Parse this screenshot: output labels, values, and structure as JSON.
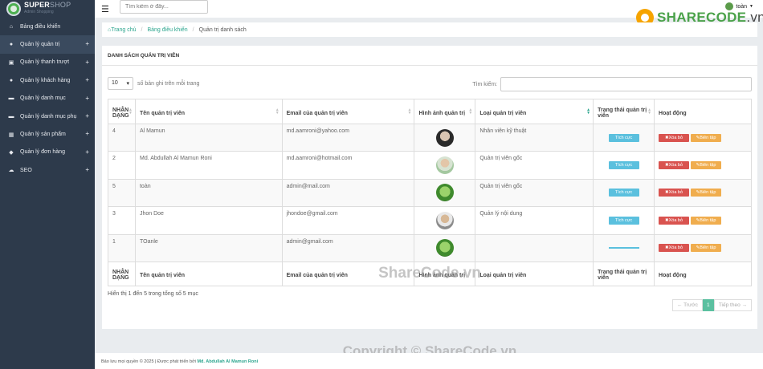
{
  "brand": {
    "title_strong": "SUPER",
    "title_light": "SHOP",
    "subtitle": "Admin Shopping",
    "logo_icon": "shop-logo-icon"
  },
  "sidebar": {
    "items": [
      {
        "label": "Bảng điều khiển",
        "icon": "home-icon",
        "glyph": "⌂",
        "expandable": false
      },
      {
        "label": "Quản lý quản trị",
        "icon": "user-icon",
        "glyph": "●",
        "expandable": true,
        "active": true
      },
      {
        "label": "Quản lý thanh trượt",
        "icon": "image-icon",
        "glyph": "▣",
        "expandable": true
      },
      {
        "label": "Quản lý khách hàng",
        "icon": "users-icon",
        "glyph": "●",
        "expandable": true
      },
      {
        "label": "Quản lý danh mục",
        "icon": "folder-icon",
        "glyph": "▬",
        "expandable": true
      },
      {
        "label": "Quản lý danh mục phụ",
        "icon": "folder-open-icon",
        "glyph": "▬",
        "expandable": true
      },
      {
        "label": "Quản lý sản phẩm",
        "icon": "grid-icon",
        "glyph": "▦",
        "expandable": true
      },
      {
        "label": "Quản lý đơn hàng",
        "icon": "tag-icon",
        "glyph": "◆",
        "expandable": true
      },
      {
        "label": "SEO",
        "icon": "cloud-icon",
        "glyph": "☁",
        "expandable": true
      }
    ],
    "plus": "+"
  },
  "topbar": {
    "menu_icon": "☰",
    "search_placeholder": "Tìm kiếm ở đây...",
    "user_name": "toàn"
  },
  "watermark": {
    "logo_main": "SHARECODE",
    "logo_suffix": ".vn",
    "center_text": "ShareCode.vn",
    "copyright": "Copyright © ShareCode.vn"
  },
  "breadcrumb": {
    "home": "Trang chủ",
    "dashboard": "Bảng điều khiển",
    "current": "Quản trị danh sách",
    "sep": "/"
  },
  "panel": {
    "title": "DANH SÁCH QUẢN TRỊ VIÊN",
    "page_length": "10",
    "length_label": "số bản ghi trên mỗi trang",
    "search_label": "Tìm kiếm:"
  },
  "table": {
    "headers": [
      "NHẬN DẠNG",
      "Tên quản trị viên",
      "Email của quản trị viên",
      "Hình ảnh quản trị",
      "Loại quản trị viên",
      "Trạng thái quản trị viên",
      "Hoạt động"
    ],
    "rows": [
      {
        "id": "4",
        "name": "Al Mamun",
        "email": "md.aamroni@yahoo.com",
        "avatar": "av1",
        "type": "Nhân viên kỹ thuật",
        "status": "Tích cực",
        "has_status": true
      },
      {
        "id": "2",
        "name": "Md. Abdullah Al Mamun Roni",
        "email": "md.aamroni@hotmail.com",
        "avatar": "av2",
        "type": "Quản trị viên gốc",
        "status": "Tích cực",
        "has_status": true
      },
      {
        "id": "5",
        "name": "toàn",
        "email": "admin@mail.com",
        "avatar": "av3",
        "type": "Quản trị viên gốc",
        "status": "Tích cực",
        "has_status": true
      },
      {
        "id": "3",
        "name": "Jhon Doe",
        "email": "jhondoe@gmail.com",
        "avatar": "av4",
        "type": "Quản lý nội dung",
        "status": "Tích cực",
        "has_status": true
      },
      {
        "id": "1",
        "name": "TOanle",
        "email": "admin@gmail.com",
        "avatar": "av3",
        "type": "",
        "status": "",
        "has_status": false
      }
    ],
    "delete_label": "Xóa bỏ",
    "edit_label": "Biên tập"
  },
  "pagination": {
    "info": "Hiển thị 1 đến 5 trong tổng số 5 mục",
    "prev": "← Trước",
    "page": "1",
    "next": "Tiếp theo →"
  },
  "footer": {
    "text": "Bảo lưu mọi quyền © 2025 | Được phát triển bởi",
    "author": "Md. Abdullah Al Mamun Roni"
  },
  "colors": {
    "sidebar_bg": "#2d3a4b",
    "accent": "#2ba58e",
    "info": "#5bc0de",
    "danger": "#d9534f",
    "warning": "#f0ad4e"
  }
}
